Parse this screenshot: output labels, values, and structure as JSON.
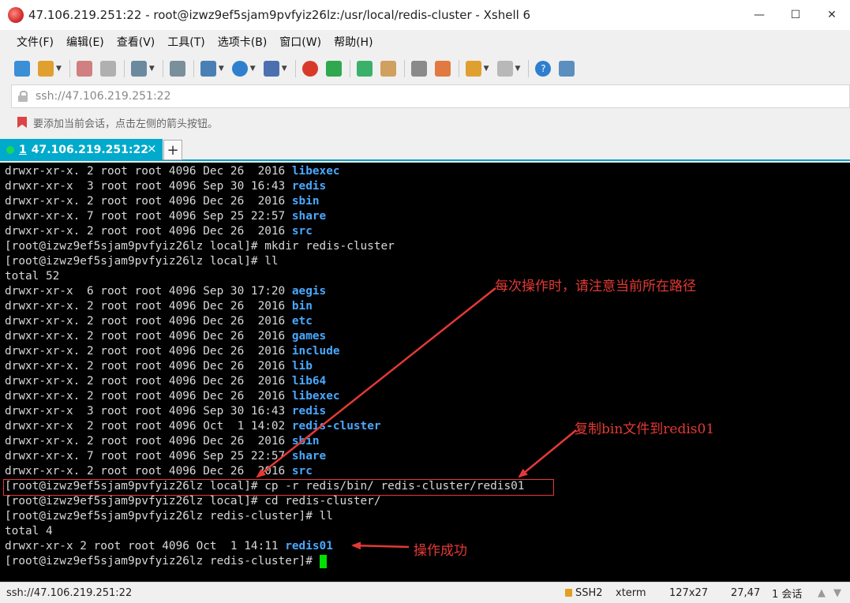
{
  "window": {
    "title": "47.106.219.251:22 - root@izwz9ef5sjam9pvfyiz26lz:/usr/local/redis-cluster - Xshell 6",
    "minimize": "—",
    "maximize": "☐",
    "close": "✕"
  },
  "menu": [
    "文件(F)",
    "编辑(E)",
    "查看(V)",
    "工具(T)",
    "选项卡(B)",
    "窗口(W)",
    "帮助(H)"
  ],
  "address": {
    "value": "ssh://47.106.219.251:22"
  },
  "hint": "要添加当前会话，点击左侧的箭头按钮。",
  "tab": {
    "number": "1",
    "label": "47.106.219.251:22",
    "close": "×",
    "add": "+"
  },
  "terminal": {
    "lines": [
      {
        "prefix": "drwxr-xr-x. 2 root root 4096 Dec 26  2016 ",
        "name": "libexec"
      },
      {
        "prefix": "drwxr-xr-x  3 root root 4096 Sep 30 16:43 ",
        "name": "redis"
      },
      {
        "prefix": "drwxr-xr-x. 2 root root 4096 Dec 26  2016 ",
        "name": "sbin"
      },
      {
        "prefix": "drwxr-xr-x. 7 root root 4096 Sep 25 22:57 ",
        "name": "share"
      },
      {
        "prefix": "drwxr-xr-x. 2 root root 4096 Dec 26  2016 ",
        "name": "src"
      },
      {
        "prefix": "[root@izwz9ef5sjam9pvfyiz26lz local]# mkdir redis-cluster",
        "name": ""
      },
      {
        "prefix": "[root@izwz9ef5sjam9pvfyiz26lz local]# ll",
        "name": ""
      },
      {
        "prefix": "total 52",
        "name": ""
      },
      {
        "prefix": "drwxr-xr-x  6 root root 4096 Sep 30 17:20 ",
        "name": "aegis"
      },
      {
        "prefix": "drwxr-xr-x. 2 root root 4096 Dec 26  2016 ",
        "name": "bin"
      },
      {
        "prefix": "drwxr-xr-x. 2 root root 4096 Dec 26  2016 ",
        "name": "etc"
      },
      {
        "prefix": "drwxr-xr-x. 2 root root 4096 Dec 26  2016 ",
        "name": "games"
      },
      {
        "prefix": "drwxr-xr-x. 2 root root 4096 Dec 26  2016 ",
        "name": "include"
      },
      {
        "prefix": "drwxr-xr-x. 2 root root 4096 Dec 26  2016 ",
        "name": "lib"
      },
      {
        "prefix": "drwxr-xr-x. 2 root root 4096 Dec 26  2016 ",
        "name": "lib64"
      },
      {
        "prefix": "drwxr-xr-x. 2 root root 4096 Dec 26  2016 ",
        "name": "libexec"
      },
      {
        "prefix": "drwxr-xr-x  3 root root 4096 Sep 30 16:43 ",
        "name": "redis"
      },
      {
        "prefix": "drwxr-xr-x  2 root root 4096 Oct  1 14:02 ",
        "name": "redis-cluster"
      },
      {
        "prefix": "drwxr-xr-x. 2 root root 4096 Dec 26  2016 ",
        "name": "sbin"
      },
      {
        "prefix": "drwxr-xr-x. 7 root root 4096 Sep 25 22:57 ",
        "name": "share"
      },
      {
        "prefix": "drwxr-xr-x. 2 root root 4096 Dec 26  2016 ",
        "name": "src"
      },
      {
        "prefix": "[root@izwz9ef5sjam9pvfyiz26lz local]# cp -r redis/bin/ redis-cluster/redis01",
        "name": ""
      },
      {
        "prefix": "[root@izwz9ef5sjam9pvfyiz26lz local]# cd redis-cluster/",
        "name": ""
      },
      {
        "prefix": "[root@izwz9ef5sjam9pvfyiz26lz redis-cluster]# ll",
        "name": ""
      },
      {
        "prefix": "total 4",
        "name": ""
      },
      {
        "prefix": "drwxr-xr-x 2 root root 4096 Oct  1 14:11 ",
        "name": "redis01"
      },
      {
        "prefix": "[root@izwz9ef5sjam9pvfyiz26lz redis-cluster]# ",
        "name": ""
      }
    ]
  },
  "annotations": {
    "path_note": "每次操作时，请注意当前所在路径",
    "copy_note": "复制bin文件到redis01",
    "success_note": "操作成功"
  },
  "status": {
    "connection": "ssh://47.106.219.251:22",
    "protocol": "SSH2",
    "terminal_type": "xterm",
    "size": "127x27",
    "position": "27,47",
    "sessions": "1 会话"
  },
  "colors": {
    "accent_tab": "#00aacc",
    "terminal_bg": "#000000",
    "dir_color": "#4aa8ff",
    "annotation_red": "#e53935",
    "cursor_green": "#00e000"
  }
}
